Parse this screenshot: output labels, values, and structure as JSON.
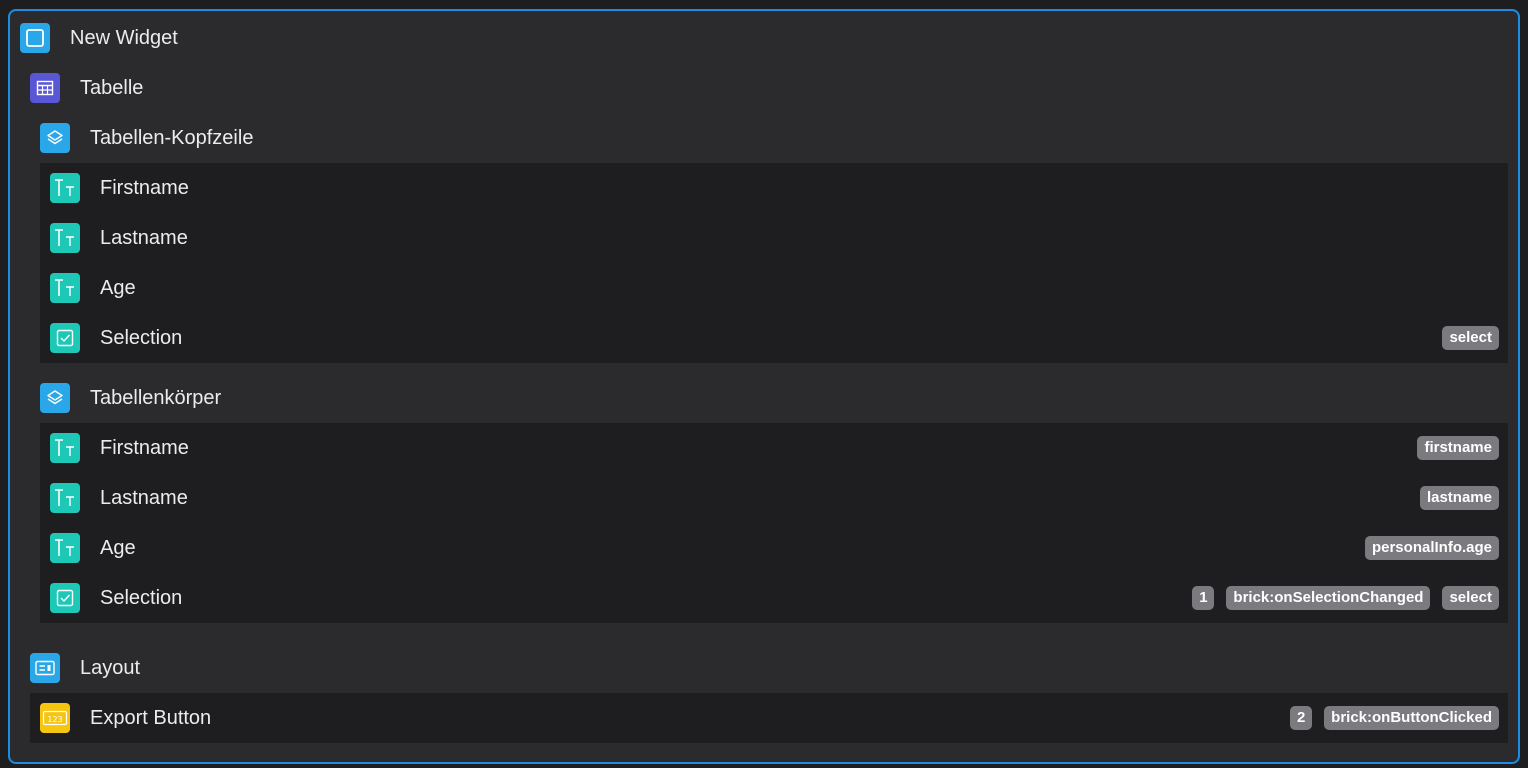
{
  "colors": {
    "accent_border": "#1a8ee6",
    "icon_cyan": "#2aa7e8",
    "icon_purple": "#5a57d6",
    "icon_teal": "#1ec8b6",
    "icon_yellow": "#f5c510",
    "tag_bg": "#7a7a7f"
  },
  "tree": {
    "root": {
      "label": "New Widget",
      "icon": "square-widget-icon"
    },
    "table": {
      "label": "Tabelle",
      "icon": "table-grid-icon"
    },
    "header": {
      "label": "Tabellen-Kopfzeile",
      "icon": "layers-icon",
      "items": [
        {
          "label": "Firstname",
          "icon": "text-icon",
          "tags": []
        },
        {
          "label": "Lastname",
          "icon": "text-icon",
          "tags": []
        },
        {
          "label": "Age",
          "icon": "text-icon",
          "tags": []
        },
        {
          "label": "Selection",
          "icon": "checkbox-icon",
          "tags": [
            "select"
          ]
        }
      ]
    },
    "body": {
      "label": "Tabellenkörper",
      "icon": "layers-icon",
      "items": [
        {
          "label": "Firstname",
          "icon": "text-icon",
          "tags": [
            "firstname"
          ]
        },
        {
          "label": "Lastname",
          "icon": "text-icon",
          "tags": [
            "lastname"
          ]
        },
        {
          "label": "Age",
          "icon": "text-icon",
          "tags": [
            "personalInfo.age"
          ]
        },
        {
          "label": "Selection",
          "icon": "checkbox-icon",
          "count": "1",
          "tags": [
            "brick:onSelectionChanged",
            "select"
          ]
        }
      ]
    },
    "layout": {
      "label": "Layout",
      "icon": "layout-icon"
    },
    "export_button": {
      "label": "Export Button",
      "icon": "number-input-icon",
      "count": "2",
      "tags": [
        "brick:onButtonClicked"
      ]
    }
  }
}
